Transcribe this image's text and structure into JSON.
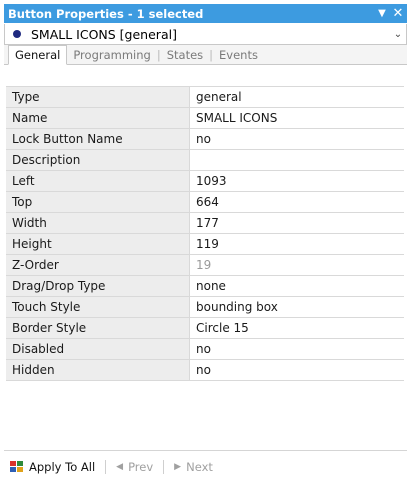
{
  "window": {
    "title": "Button Properties - 1 selected",
    "pin_icon": "dropdown-arrow-icon",
    "close_icon": "close-icon"
  },
  "selector": {
    "value": "SMALL ICONS  [general]",
    "bullet_color": "#1f2a80"
  },
  "tabs": [
    {
      "label": "General",
      "active": true
    },
    {
      "label": "Programming",
      "active": false
    },
    {
      "label": "States",
      "active": false
    },
    {
      "label": "Events",
      "active": false
    }
  ],
  "properties": [
    {
      "name": "Type",
      "value": "general"
    },
    {
      "name": "Name",
      "value": "SMALL ICONS"
    },
    {
      "name": "Lock Button Name",
      "value": "no"
    },
    {
      "name": "Description",
      "value": ""
    },
    {
      "name": "Left",
      "value": "1093"
    },
    {
      "name": "Top",
      "value": "664"
    },
    {
      "name": "Width",
      "value": "177"
    },
    {
      "name": "Height",
      "value": "119"
    },
    {
      "name": "Z-Order",
      "value": "19",
      "muted": true
    },
    {
      "name": "Drag/Drop Type",
      "value": "none"
    },
    {
      "name": "Touch Style",
      "value": "bounding box"
    },
    {
      "name": "Border Style",
      "value": "Circle 15"
    },
    {
      "name": "Disabled",
      "value": "no"
    },
    {
      "name": "Hidden",
      "value": "no"
    }
  ],
  "footer": {
    "apply_label": "Apply To All",
    "prev_label": "Prev",
    "next_label": "Next"
  },
  "colors": {
    "titlebar": "#3d9be0",
    "accent": "#1f2a80"
  }
}
